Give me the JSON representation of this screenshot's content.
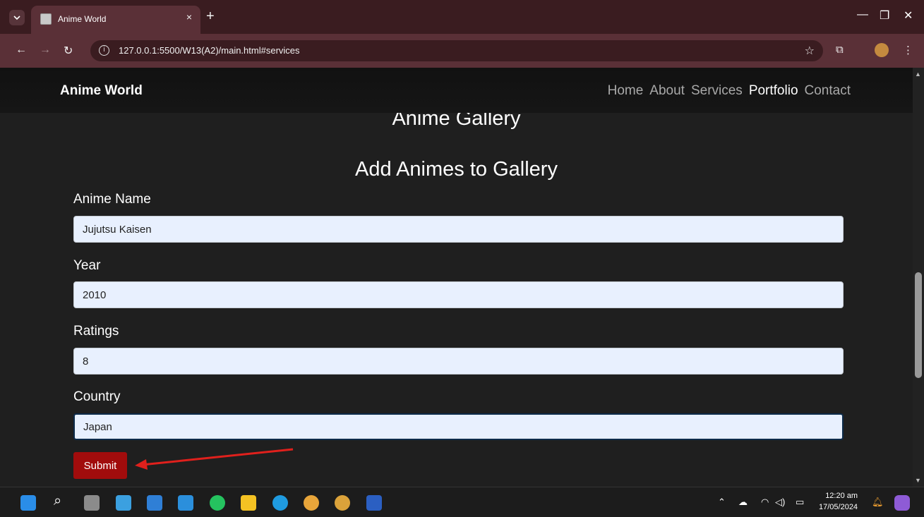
{
  "browser": {
    "tab_title": "Anime World",
    "tab_close": "×",
    "new_tab": "+",
    "url": "127.0.0.1:5500/W13(A2)/main.html#services",
    "minimize": "—",
    "restore": "❐",
    "close": "✕"
  },
  "navbar": {
    "brand": "Anime World",
    "links": [
      {
        "label": "Home",
        "active": false
      },
      {
        "label": "About",
        "active": false
      },
      {
        "label": "Services",
        "active": false
      },
      {
        "label": "Portfolio",
        "active": true
      },
      {
        "label": "Contact",
        "active": false
      }
    ]
  },
  "page": {
    "gallery_title": "Anime Gallery",
    "form_title": "Add Animes to Gallery",
    "fields": [
      {
        "label": "Anime Name",
        "value": "Jujutsu Kaisen"
      },
      {
        "label": "Year",
        "value": "2010"
      },
      {
        "label": "Ratings",
        "value": "8"
      },
      {
        "label": "Country",
        "value": "Japan"
      }
    ],
    "submit_label": "Submit"
  },
  "taskbar": {
    "time": "12:20 am",
    "date": "17/05/2024"
  },
  "colors": {
    "accent": "#a10c0c",
    "annotation_arrow": "#e0201c"
  }
}
